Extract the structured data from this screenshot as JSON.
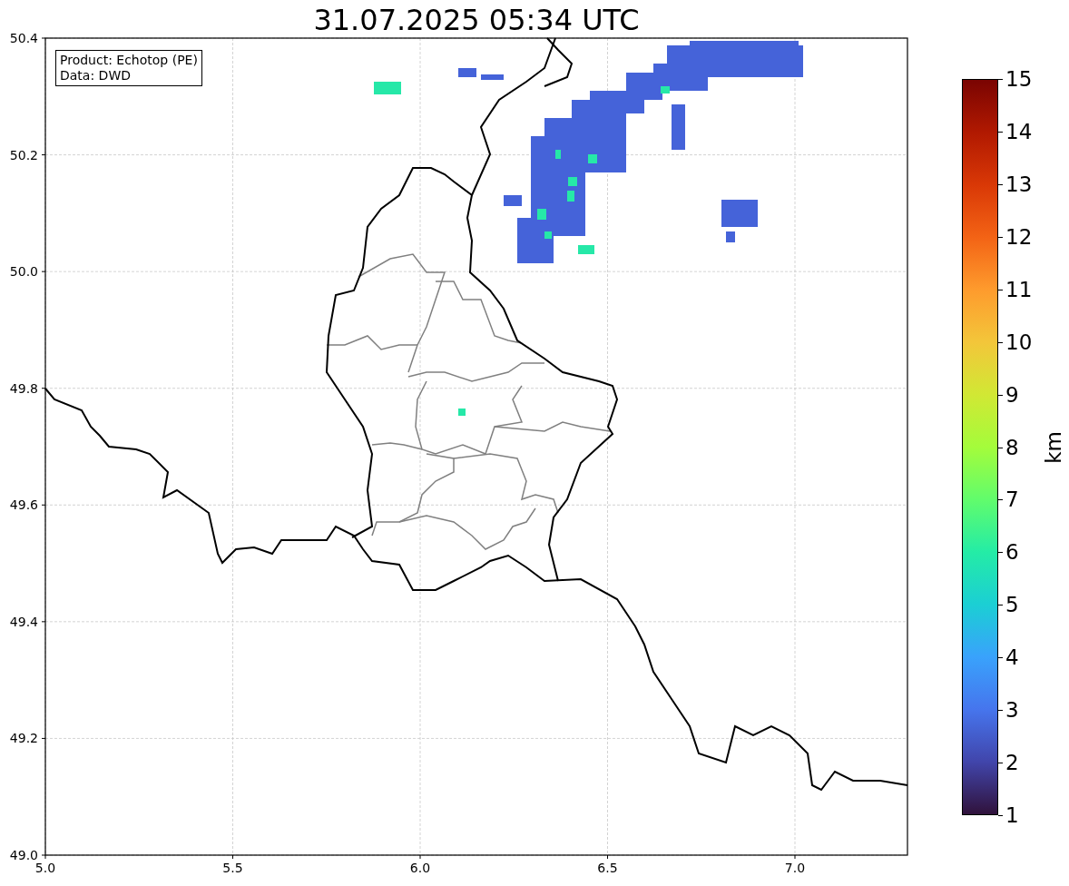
{
  "title": "31.07.2025 05:34 UTC",
  "legend": {
    "lines": [
      "Product: Echotop (PE)",
      "Data: DWD"
    ]
  },
  "map": {
    "xticks": [
      "5.0",
      "5.5",
      "6.0",
      "6.5",
      "7.0"
    ],
    "yticks": [
      "50.4",
      "50.2",
      "50.0",
      "49.8",
      "49.6",
      "49.4",
      "49.2",
      "49.0"
    ]
  },
  "colorbar": {
    "label": "km",
    "ticks": [
      "15",
      "14",
      "13",
      "12",
      "11",
      "10",
      "9",
      "8",
      "7",
      "6",
      "5",
      "4",
      "3",
      "2",
      "1"
    ]
  }
}
